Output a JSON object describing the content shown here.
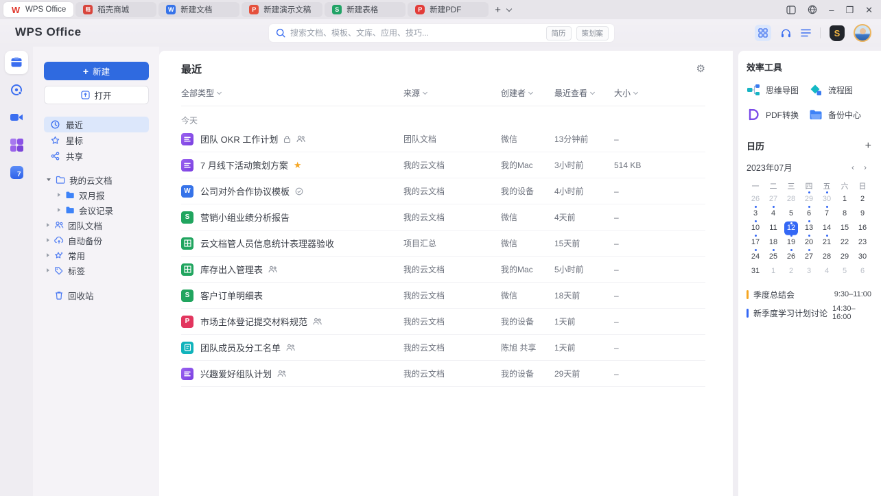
{
  "chrome": {
    "tabs": [
      {
        "label": "WPS Office",
        "active": true
      },
      {
        "label": "稻壳商城"
      },
      {
        "label": "新建文档",
        "glyph": "W"
      },
      {
        "label": "新建演示文稿",
        "glyph": "P"
      },
      {
        "label": "新建表格",
        "glyph": "S"
      },
      {
        "label": "新建PDF",
        "glyph": "P"
      }
    ],
    "new_tab": "+",
    "controls": {
      "minimize": "–",
      "maximize": "❐",
      "close": "✕"
    }
  },
  "header": {
    "logo": "WPS Office",
    "search": {
      "placeholder": "搜索文档、模板、文库、应用、技巧...",
      "tags": [
        "简历",
        "策划案"
      ]
    }
  },
  "rail": {
    "items": [
      "documents",
      "clock",
      "meeting",
      "apps",
      "calendar"
    ],
    "calendar_badge": "7"
  },
  "sidebar": {
    "new_label": "新建",
    "open_label": "打开",
    "nav": [
      {
        "label": "最近",
        "active": true
      },
      {
        "label": "星标"
      },
      {
        "label": "共享"
      }
    ],
    "tree": [
      {
        "label": "我的云文档",
        "icon": "folder",
        "expanded": true
      },
      {
        "label": "双月报",
        "icon": "folder-solid",
        "child": true
      },
      {
        "label": "会议记录",
        "icon": "folder-solid",
        "child": true
      },
      {
        "label": "团队文档",
        "icon": "team"
      },
      {
        "label": "自动备份",
        "icon": "cloud-backup"
      },
      {
        "label": "常用",
        "icon": "star-sparkle"
      },
      {
        "label": "标签",
        "icon": "tag"
      }
    ],
    "trash_label": "回收站"
  },
  "main": {
    "title": "最近",
    "filters": [
      "全部类型",
      "来源",
      "创建者",
      "最近查看",
      "大小"
    ],
    "section_label": "今天",
    "rows": [
      {
        "icon": "wps-doc",
        "title": "团队 OKR 工作计划",
        "badges": [
          "lock",
          "people"
        ],
        "source": "团队文档",
        "creator": "微信",
        "viewed": "13分钟前",
        "size": "–"
      },
      {
        "icon": "wps-doc",
        "title": "7 月线下活动策划方案",
        "badges": [
          "star"
        ],
        "source": "我的云文档",
        "creator": "我的Mac",
        "viewed": "3小时前",
        "size": "514 KB"
      },
      {
        "icon": "word",
        "title": "公司对外合作协议模板",
        "badges": [
          "check"
        ],
        "source": "我的云文档",
        "creator": "我的设备",
        "viewed": "4小时前",
        "size": "–"
      },
      {
        "icon": "sheet-s",
        "title": "营销小组业绩分析报告",
        "badges": [],
        "source": "我的云文档",
        "creator": "微信",
        "viewed": "4天前",
        "size": "–"
      },
      {
        "icon": "sheet-grid",
        "title": "云文档管人员信息统计表理器验收",
        "badges": [],
        "source": "项目汇总",
        "creator": "微信",
        "viewed": "15天前",
        "size": "–"
      },
      {
        "icon": "sheet-grid",
        "title": "库存出入管理表",
        "badges": [
          "people"
        ],
        "source": "我的云文档",
        "creator": "我的Mac",
        "viewed": "5小时前",
        "size": "–"
      },
      {
        "icon": "sheet-s",
        "title": "客户订单明细表",
        "badges": [],
        "source": "我的云文档",
        "creator": "微信",
        "viewed": "18天前",
        "size": "–"
      },
      {
        "icon": "pdf",
        "title": "市场主体登记提交材料规范",
        "badges": [
          "people"
        ],
        "source": "我的云文档",
        "creator": "我的设备",
        "viewed": "1天前",
        "size": "–"
      },
      {
        "icon": "form",
        "title": "团队成员及分工名单",
        "badges": [
          "people"
        ],
        "source": "我的云文档",
        "creator": "陈旭 共享",
        "viewed": "1天前",
        "size": "–"
      },
      {
        "icon": "wps-doc",
        "title": "兴趣爱好组队计划",
        "badges": [
          "people"
        ],
        "source": "我的云文档",
        "creator": "我的设备",
        "viewed": "29天前",
        "size": "–"
      }
    ]
  },
  "tools": {
    "title": "效率工具",
    "items": [
      {
        "label": "思维导图",
        "icon": "mindmap"
      },
      {
        "label": "流程图",
        "icon": "flowchart"
      },
      {
        "label": "PDF转换",
        "icon": "pdf-convert"
      },
      {
        "label": "备份中心",
        "icon": "backup"
      }
    ]
  },
  "calendar": {
    "title": "日历",
    "add": "+",
    "month": "2023年07月",
    "day_headers": [
      "一",
      "二",
      "三",
      "四",
      "五",
      "六",
      "日"
    ],
    "weeks": [
      [
        {
          "n": 26,
          "muted": true
        },
        {
          "n": 27,
          "muted": true
        },
        {
          "n": 28,
          "muted": true
        },
        {
          "n": 29,
          "muted": true,
          "dot": true
        },
        {
          "n": 30,
          "muted": true,
          "dot": true
        },
        {
          "n": 1
        },
        {
          "n": 2
        }
      ],
      [
        {
          "n": 3,
          "dot": true
        },
        {
          "n": 4,
          "dot": true
        },
        {
          "n": 5
        },
        {
          "n": 6,
          "dot": true
        },
        {
          "n": 7,
          "dot": true
        },
        {
          "n": 8
        },
        {
          "n": 9
        }
      ],
      [
        {
          "n": 10,
          "dot": true
        },
        {
          "n": 11
        },
        {
          "n": 12,
          "selected": true,
          "dot": true
        },
        {
          "n": 13,
          "dot": true
        },
        {
          "n": 14
        },
        {
          "n": 15
        },
        {
          "n": 16
        }
      ],
      [
        {
          "n": 17,
          "dot": true
        },
        {
          "n": 18
        },
        {
          "n": 19,
          "dot": true
        },
        {
          "n": 20,
          "dot": true
        },
        {
          "n": 21,
          "dot": true
        },
        {
          "n": 22
        },
        {
          "n": 23
        }
      ],
      [
        {
          "n": 24,
          "dot": true
        },
        {
          "n": 25,
          "dot": true
        },
        {
          "n": 26,
          "dot": true
        },
        {
          "n": 27,
          "dot": true
        },
        {
          "n": 28
        },
        {
          "n": 29
        },
        {
          "n": 30
        }
      ],
      [
        {
          "n": 31
        },
        {
          "n": 1,
          "muted": true
        },
        {
          "n": 2,
          "muted": true
        },
        {
          "n": 3,
          "muted": true
        },
        {
          "n": 4,
          "muted": true
        },
        {
          "n": 5,
          "muted": true
        },
        {
          "n": 6,
          "muted": true
        }
      ]
    ],
    "events": [
      {
        "title": "季度总结会",
        "time": "9:30–11:00",
        "color": "#f5a623"
      },
      {
        "title": "新季度学习计划讨论",
        "time": "14:30–16:00",
        "color": "#3468f5"
      }
    ]
  },
  "colors": {
    "accent_blue": "#2f6ae0",
    "doc_purple": "#8a52e8",
    "word_blue": "#3673e9",
    "sheet_green": "#21a55f",
    "pdf_red": "#e2355e",
    "form_teal": "#10b3bb",
    "star_gold": "#f5a623",
    "selected_day": "#3468f5"
  }
}
